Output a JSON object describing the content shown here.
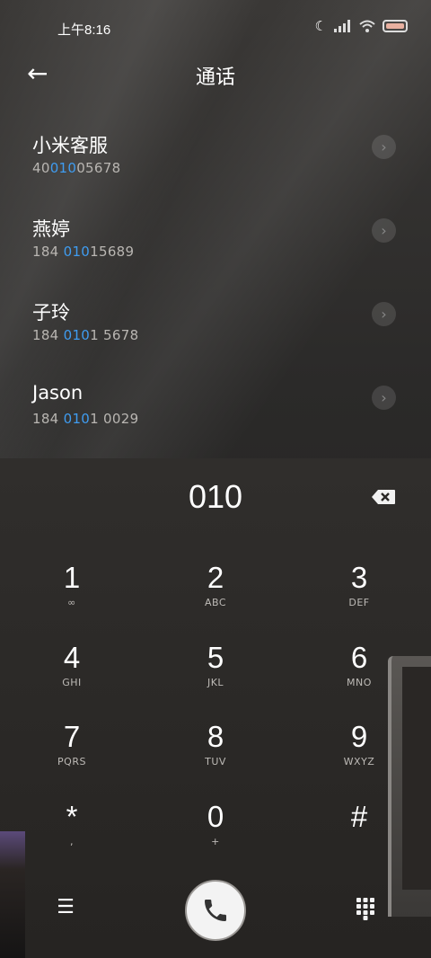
{
  "status_bar": {
    "time": "上午8:16"
  },
  "header": {
    "title": "通话"
  },
  "contacts": [
    {
      "name": "小米客服",
      "num_pre": "40",
      "num_hl": "010",
      "num_post": "05678"
    },
    {
      "name": "燕婷",
      "num_pre": "184 ",
      "num_hl": "010",
      "num_post": "15689"
    },
    {
      "name": "子玲",
      "num_pre": "184 ",
      "num_hl": "010",
      "num_post": "1 5678"
    },
    {
      "name": "Jason",
      "num_pre": "184 ",
      "num_hl": "010",
      "num_post": "1 0029"
    }
  ],
  "dial": {
    "number": "010"
  },
  "keypad": [
    {
      "digit": "1",
      "letters": "∞"
    },
    {
      "digit": "2",
      "letters": "ABC"
    },
    {
      "digit": "3",
      "letters": "DEF"
    },
    {
      "digit": "4",
      "letters": "GHI"
    },
    {
      "digit": "5",
      "letters": "JKL"
    },
    {
      "digit": "6",
      "letters": "MNO"
    },
    {
      "digit": "7",
      "letters": "PQRS"
    },
    {
      "digit": "8",
      "letters": "TUV"
    },
    {
      "digit": "9",
      "letters": "WXYZ"
    },
    {
      "digit": "*",
      "letters": ","
    },
    {
      "digit": "0",
      "letters": "+"
    },
    {
      "digit": "#",
      "letters": ""
    }
  ],
  "colors": {
    "highlight": "#3f9cf0",
    "call_button": "#f3f3f3"
  },
  "icons": {
    "back": "arrow-left-icon",
    "chevron": "chevron-right-icon",
    "backspace": "backspace-icon",
    "menu": "menu-icon",
    "call": "phone-icon",
    "keypad": "dialpad-icon"
  }
}
